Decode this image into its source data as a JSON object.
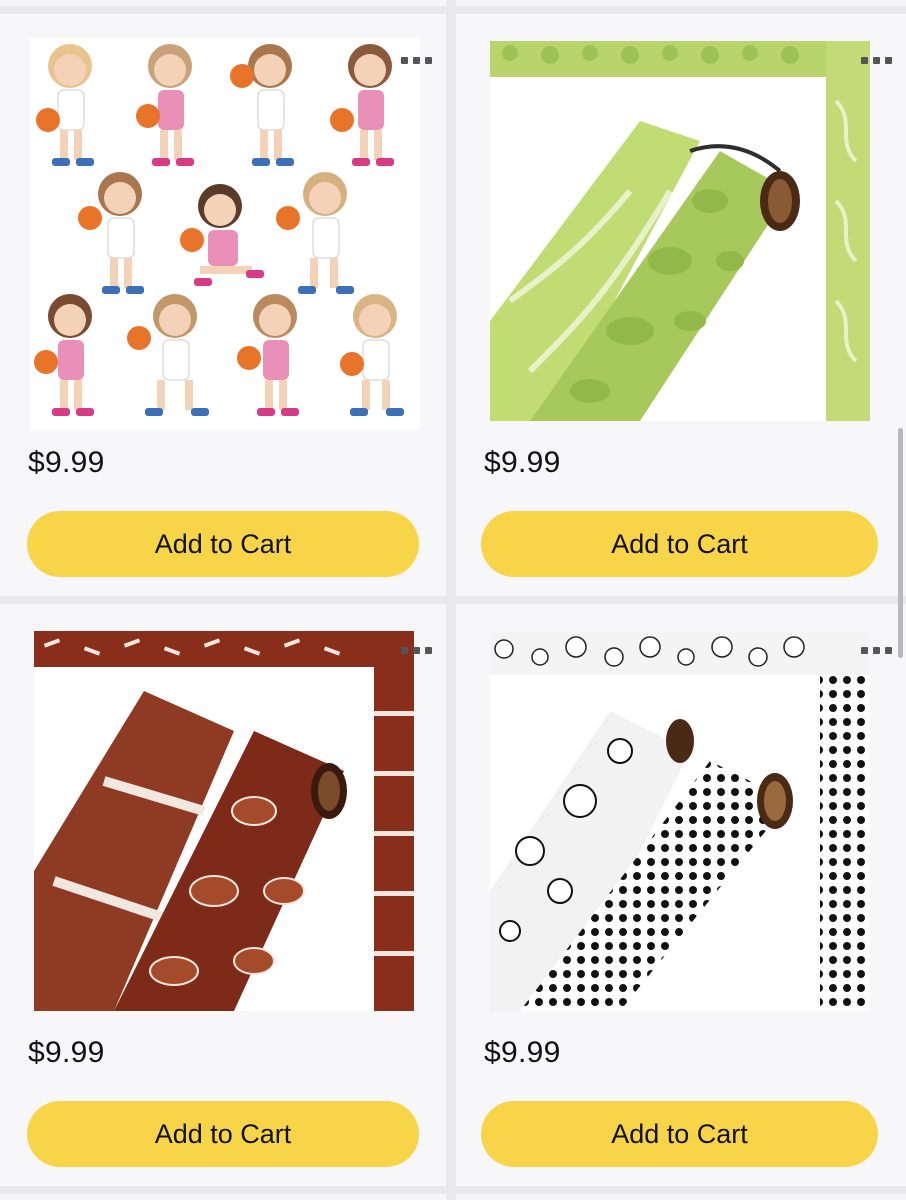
{
  "products": [
    {
      "price": "$9.99",
      "cart_label": "Add to Cart",
      "image": "basketball-kids-cutouts"
    },
    {
      "price": "$9.99",
      "cart_label": "Add to Cart",
      "image": "tennis-ball-border-rolls"
    },
    {
      "price": "$9.99",
      "cart_label": "Add to Cart",
      "image": "football-border-rolls"
    },
    {
      "price": "$9.99",
      "cart_label": "Add to Cart",
      "image": "soccer-ball-border-rolls"
    }
  ],
  "icons": {
    "more": "more-options-icon"
  },
  "colors": {
    "button": "#f8d448",
    "background": "#f7f7f9",
    "divider": "#e9e9ec"
  }
}
